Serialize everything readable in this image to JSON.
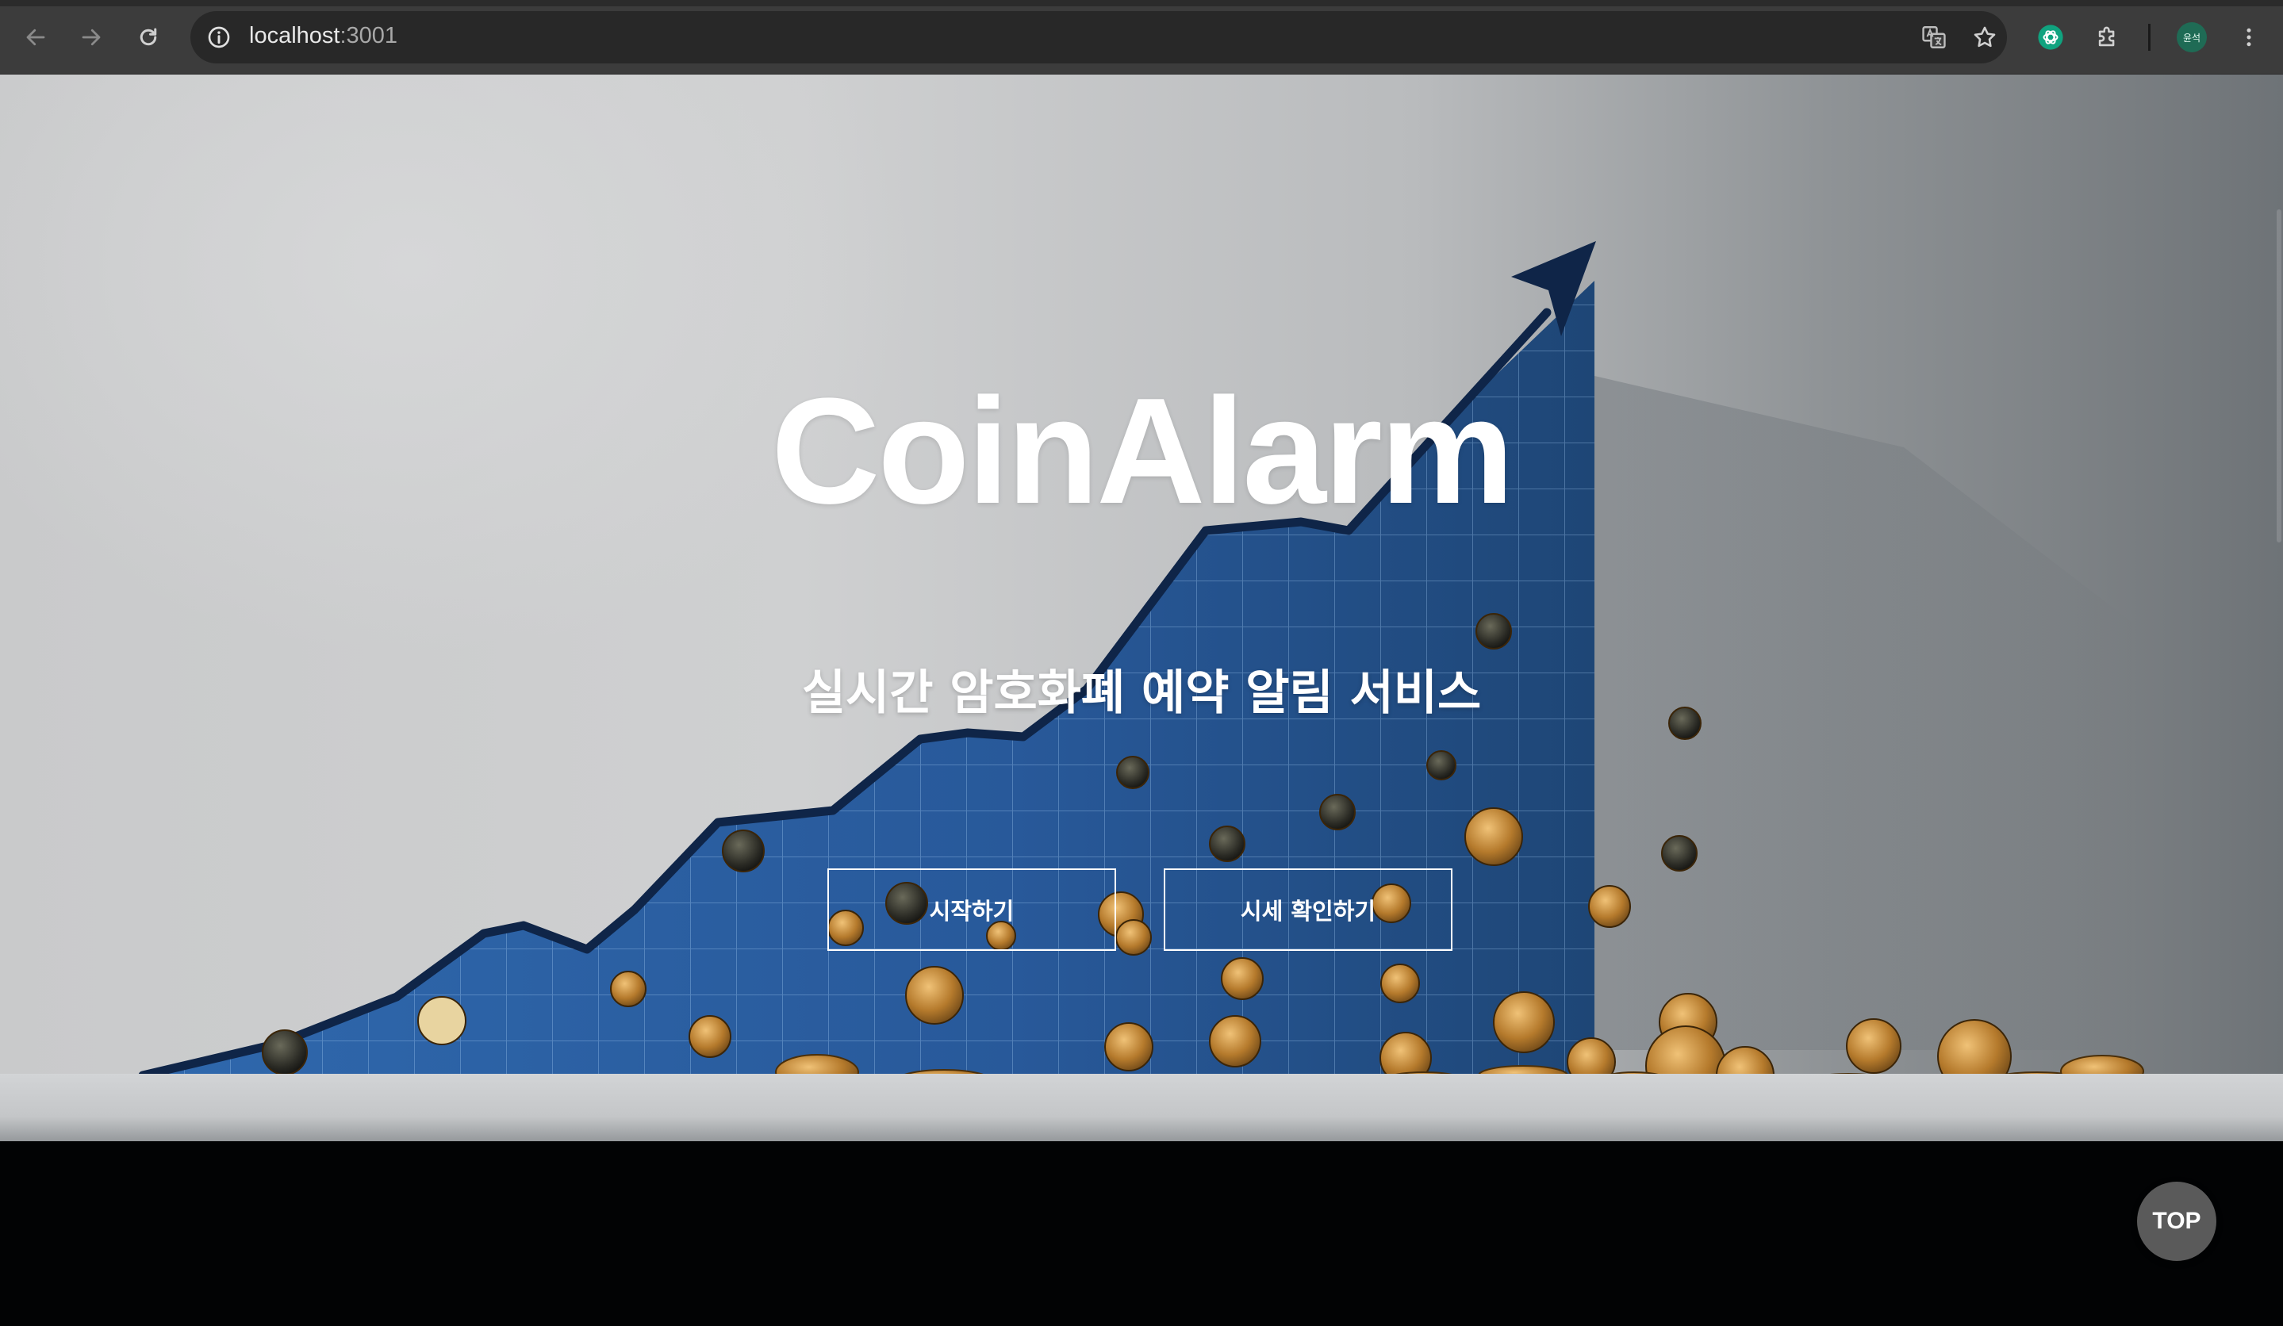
{
  "browser": {
    "url_host": "localhost",
    "url_port": ":3001",
    "profile_initials": "윤석",
    "icons": {
      "back": "back-arrow-icon",
      "forward": "forward-arrow-icon",
      "reload": "reload-icon",
      "site_info": "info-icon",
      "translate": "translate-icon",
      "bookmark": "star-icon",
      "extension_chatgpt": "chatgpt-icon",
      "extensions": "puzzle-icon",
      "menu": "kebab-menu-icon"
    }
  },
  "hero": {
    "title": "CoinAlarm",
    "subtitle": "실시간 암호화폐 예약 알림 서비스",
    "start_button": "시작하기",
    "prices_button": "시세 확인하기"
  },
  "top_button": "TOP",
  "colors": {
    "chrome_bg": "#3c3c3c",
    "omnibox_bg": "#282828",
    "chart_blue": "#2a5a9a",
    "chart_line": "#0f2548",
    "coin_gold": "#c8913a",
    "top_button_bg": "#5a5a5a",
    "floor": "#020304"
  }
}
